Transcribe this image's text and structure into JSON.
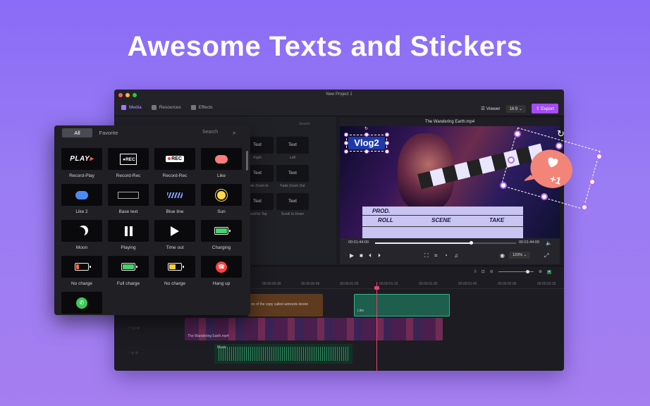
{
  "headline": "Awesome Texts and Stickers",
  "window": {
    "title": "New Project 1"
  },
  "toolbar": {
    "tabs": [
      {
        "label": "Media",
        "icon": "media-icon"
      },
      {
        "label": "Resources",
        "icon": "resources-icon"
      },
      {
        "label": "Effects",
        "icon": "effects-icon"
      }
    ],
    "viewer_label": "Viewer",
    "ratio": "16:9",
    "export_label": "Export"
  },
  "background_panel": {
    "search_placeholder": "Search",
    "cells": [
      {
        "box": "Text",
        "label": "Right"
      },
      {
        "box": "Text",
        "label": "Left"
      },
      {
        "box": "Text",
        "label": "Fade Zoom In"
      },
      {
        "box": "Text",
        "label": "Fade Zoom Out"
      },
      {
        "box": "Text",
        "label": "Scroll to Top"
      },
      {
        "box": "Text",
        "label": "Scroll to Down"
      }
    ]
  },
  "sticker_panel": {
    "tabs": {
      "all": "All",
      "favorite": "Favorite"
    },
    "search_placeholder": "Search",
    "stickers": [
      {
        "label": "Record-Play",
        "icon": "play-word"
      },
      {
        "label": "Record-Rec",
        "icon": "rec-frame"
      },
      {
        "label": "Record-Rec",
        "icon": "rec-pill"
      },
      {
        "label": "Like",
        "icon": "like-bubble"
      },
      {
        "label": "Like 2",
        "icon": "like2-bubble"
      },
      {
        "label": "Base text",
        "icon": "base-text"
      },
      {
        "label": "Blue line",
        "icon": "blue-line"
      },
      {
        "label": "Sun",
        "icon": "sun-icon"
      },
      {
        "label": "Moon",
        "icon": "moon-icon"
      },
      {
        "label": "Playing",
        "icon": "pause-icon"
      },
      {
        "label": "Time out",
        "icon": "play-icon"
      },
      {
        "label": "Charging",
        "icon": "battery-charging"
      },
      {
        "label": "No charge",
        "icon": "battery-empty"
      },
      {
        "label": "Full charge",
        "icon": "battery-full"
      },
      {
        "label": "No charge",
        "icon": "battery-half"
      },
      {
        "label": "Hang up",
        "icon": "hang-up-icon"
      },
      {
        "label": "",
        "icon": "phone-icon"
      }
    ],
    "sticker_text": {
      "play": "PLAY",
      "rec": "REC"
    }
  },
  "preview": {
    "file_name": "The Wandering Earth.mp4",
    "current_time": "00:01:44:00",
    "total_time": "00:01:44:00",
    "progress": 0.68,
    "zoom": "120%",
    "slate": {
      "prod": "PROD.",
      "roll": "ROLL",
      "scene": "SCENE",
      "take": "TAKE"
    },
    "text_overlay": "Vlog2",
    "sticker_text": "+1"
  },
  "timeline": {
    "ticks": [
      "00:00:00:30",
      "00:00:00:45",
      "00:00:01:00",
      "00:00:01:15",
      "00:00:01:30",
      "00:00:01:45",
      "00:00:02:00",
      "00:00:02:15"
    ],
    "orange_clip_text": "on of the copy called adrowds desire",
    "green_clip_text": "Like",
    "video_clip_text": "The Wandering Earth.mp4",
    "audio_clip_text": "Music"
  },
  "colors": {
    "accent": "#a44cf3",
    "background_top": "#8a6cf6",
    "selection_handle": "#b368f5",
    "playhead": "#e5456f"
  }
}
